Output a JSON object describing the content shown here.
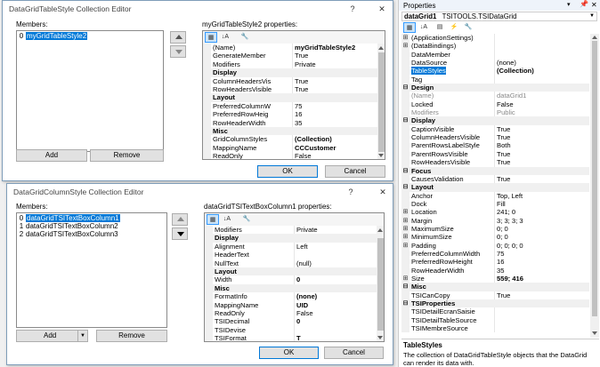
{
  "win1": {
    "title": "DataGridTableStyle Collection Editor",
    "help": "?",
    "close": "✕",
    "members_label": "Members:",
    "members": [
      {
        "idx": "0",
        "name": "myGridTableStyle2"
      }
    ],
    "props_label": "myGridTableStyle2 properties:",
    "rows": [
      {
        "type": "prop",
        "name": "(Name)",
        "value": "myGridTableStyle2",
        "bold": true
      },
      {
        "type": "prop",
        "name": "GenerateMember",
        "value": "True"
      },
      {
        "type": "prop",
        "name": "Modifiers",
        "value": "Private"
      },
      {
        "type": "cat",
        "name": "Display"
      },
      {
        "type": "prop",
        "name": "ColumnHeadersVis",
        "value": "True"
      },
      {
        "type": "prop",
        "name": "RowHeadersVisible",
        "value": "True"
      },
      {
        "type": "cat",
        "name": "Layout"
      },
      {
        "type": "prop",
        "name": "PreferredColumnW",
        "value": "75"
      },
      {
        "type": "prop",
        "name": "PreferredRowHeig",
        "value": "16"
      },
      {
        "type": "prop",
        "name": "RowHeaderWidth",
        "value": "35"
      },
      {
        "type": "cat",
        "name": "Misc"
      },
      {
        "type": "prop",
        "name": "GridColumnStyles",
        "value": "(Collection)",
        "bold": true
      },
      {
        "type": "prop",
        "name": "MappingName",
        "value": "CCCustomer",
        "bold": true
      },
      {
        "type": "prop",
        "name": "ReadOnly",
        "value": "False"
      }
    ],
    "add": "Add",
    "remove": "Remove",
    "ok": "OK",
    "cancel": "Cancel"
  },
  "win2": {
    "title": "DataGridColumnStyle Collection Editor",
    "help": "?",
    "close": "✕",
    "members_label": "Members:",
    "members": [
      {
        "idx": "0",
        "name": "dataGridTSITextBoxColumn1"
      },
      {
        "idx": "1",
        "name": "dataGridTSITextBoxColumn2"
      },
      {
        "idx": "2",
        "name": "dataGridTSITextBoxColumn3"
      }
    ],
    "props_label": "dataGridTSITextBoxColumn1 properties:",
    "rows": [
      {
        "type": "prop",
        "name": "Modifiers",
        "value": "Private"
      },
      {
        "type": "cat",
        "name": "Display"
      },
      {
        "type": "prop",
        "name": "Alignment",
        "value": "Left"
      },
      {
        "type": "prop",
        "name": "HeaderText",
        "value": ""
      },
      {
        "type": "prop",
        "name": "NullText",
        "value": "(null)"
      },
      {
        "type": "cat",
        "name": "Layout"
      },
      {
        "type": "prop",
        "name": "Width",
        "value": "0",
        "bold": true
      },
      {
        "type": "cat",
        "name": "Misc"
      },
      {
        "type": "prop",
        "name": "FormatInfo",
        "value": "(none)",
        "bold": true
      },
      {
        "type": "prop",
        "name": "MappingName",
        "value": "UID",
        "bold": true
      },
      {
        "type": "prop",
        "name": "ReadOnly",
        "value": "False"
      },
      {
        "type": "prop",
        "name": "TSIDecimal",
        "value": "0",
        "bold": true
      },
      {
        "type": "prop",
        "name": "TSIDevise",
        "value": ""
      },
      {
        "type": "prop",
        "name": "TSIFormat",
        "value": "T",
        "bold": true
      }
    ],
    "add": "Add",
    "remove": "Remove",
    "ok": "OK",
    "cancel": "Cancel"
  },
  "properties": {
    "title": "Properties",
    "object_name": "dataGrid1",
    "object_type": "TSITOOLS.TSIDataGrid",
    "rows": [
      {
        "type": "prop",
        "exp": "⊞",
        "name": "(ApplicationSettings)",
        "value": ""
      },
      {
        "type": "prop",
        "exp": "⊞",
        "name": "(DataBindings)",
        "value": ""
      },
      {
        "type": "prop",
        "name": "DataMember",
        "value": ""
      },
      {
        "type": "prop",
        "name": "DataSource",
        "value": "(none)"
      },
      {
        "type": "prop",
        "name": "TableStyles",
        "value": "(Collection)",
        "bold": true,
        "selected": true
      },
      {
        "type": "prop",
        "name": "Tag",
        "value": ""
      },
      {
        "type": "cat",
        "exp": "⊟",
        "name": "Design"
      },
      {
        "type": "prop",
        "name": "(Name)",
        "value": "dataGrid1",
        "gray": true
      },
      {
        "type": "prop",
        "name": "Locked",
        "value": "False"
      },
      {
        "type": "prop",
        "name": "Modifiers",
        "value": "Public",
        "gray": true
      },
      {
        "type": "cat",
        "exp": "⊟",
        "name": "Display"
      },
      {
        "type": "prop",
        "name": "CaptionVisible",
        "value": "True"
      },
      {
        "type": "prop",
        "name": "ColumnHeadersVisible",
        "value": "True"
      },
      {
        "type": "prop",
        "name": "ParentRowsLabelStyle",
        "value": "Both"
      },
      {
        "type": "prop",
        "name": "ParentRowsVisible",
        "value": "True"
      },
      {
        "type": "prop",
        "name": "RowHeadersVisible",
        "value": "True"
      },
      {
        "type": "cat",
        "exp": "⊟",
        "name": "Focus"
      },
      {
        "type": "prop",
        "name": "CausesValidation",
        "value": "True"
      },
      {
        "type": "cat",
        "exp": "⊟",
        "name": "Layout"
      },
      {
        "type": "prop",
        "name": "Anchor",
        "value": "Top, Left"
      },
      {
        "type": "prop",
        "name": "Dock",
        "value": "Fill"
      },
      {
        "type": "prop",
        "exp": "⊞",
        "name": "Location",
        "value": "241; 0"
      },
      {
        "type": "prop",
        "exp": "⊞",
        "name": "Margin",
        "value": "3; 3; 3; 3"
      },
      {
        "type": "prop",
        "exp": "⊞",
        "name": "MaximumSize",
        "value": "0; 0"
      },
      {
        "type": "prop",
        "exp": "⊞",
        "name": "MinimumSize",
        "value": "0; 0"
      },
      {
        "type": "prop",
        "exp": "⊞",
        "name": "Padding",
        "value": "0; 0; 0; 0"
      },
      {
        "type": "prop",
        "name": "PreferredColumnWidth",
        "value": "75"
      },
      {
        "type": "prop",
        "name": "PreferredRowHeight",
        "value": "16"
      },
      {
        "type": "prop",
        "name": "RowHeaderWidth",
        "value": "35"
      },
      {
        "type": "prop",
        "exp": "⊞",
        "name": "Size",
        "value": "559; 416",
        "bold": true
      },
      {
        "type": "cat",
        "exp": "⊟",
        "name": "Misc"
      },
      {
        "type": "prop",
        "name": "TSICanCopy",
        "value": "True"
      },
      {
        "type": "cat",
        "exp": "⊟",
        "name": "TSIProperties"
      },
      {
        "type": "prop",
        "name": "TSIDetailEcranSaisie",
        "value": ""
      },
      {
        "type": "prop",
        "name": "TSIDetailTableSource",
        "value": ""
      },
      {
        "type": "prop",
        "name": "TSIMembreSource",
        "value": ""
      }
    ],
    "desc_title": "TableStyles",
    "desc_text": "The collection of DataGridTableStyle objects that the DataGrid can render its data with."
  },
  "colors": {
    "selection": "#0078d7",
    "category_bg": "#f0f0f0",
    "button_face": "#e1e1e1"
  }
}
